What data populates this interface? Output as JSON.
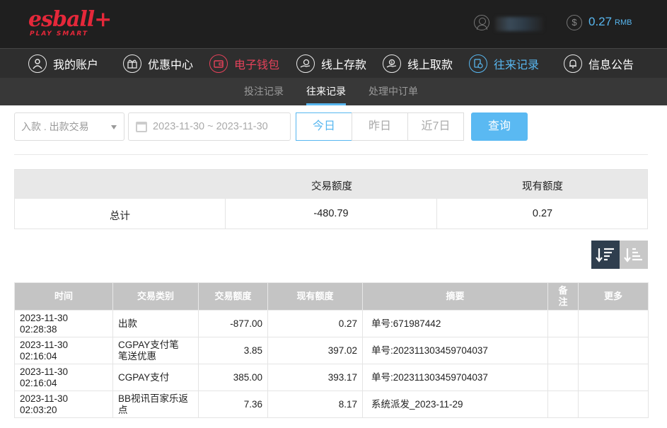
{
  "brand": {
    "logo_text": "esball+",
    "logo_sub": "PLAY SMART"
  },
  "header": {
    "balance": "0.27",
    "currency": "RMB",
    "user_icon": "user-icon",
    "coin_icon": "dollar-coin-icon"
  },
  "main_nav": [
    {
      "label": "我的账户",
      "icon": "user-circle-icon"
    },
    {
      "label": "优惠中心",
      "icon": "gift-icon"
    },
    {
      "label": "电子钱包",
      "icon": "wallet-icon"
    },
    {
      "label": "线上存款",
      "icon": "deposit-hand-icon"
    },
    {
      "label": "线上取款",
      "icon": "withdraw-hand-icon"
    },
    {
      "label": "往来记录",
      "icon": "record-clock-icon"
    },
    {
      "label": "信息公告",
      "icon": "bell-icon"
    }
  ],
  "sub_nav": [
    {
      "label": "投注记录"
    },
    {
      "label": "往来记录"
    },
    {
      "label": "处理中订单"
    }
  ],
  "filters": {
    "type_select": "入款 . 出款交易",
    "date_range": "2023-11-30 ~ 2023-11-30",
    "quick": [
      "今日",
      "昨日",
      "近7日"
    ],
    "search_label": "查询"
  },
  "summary": {
    "headers": [
      "",
      "交易额度",
      "现有额度"
    ],
    "row": {
      "label": "总计",
      "amount": "-480.79",
      "balance": "0.27"
    }
  },
  "records": {
    "headers": [
      "时间",
      "交易类别",
      "交易额度",
      "现有额度",
      "摘要",
      "备注",
      "更多"
    ],
    "rows": [
      {
        "time": "2023-11-30 02:28:38",
        "type": "出款",
        "amount": "-877.00",
        "balance": "0.27",
        "summary": "单号:671987442",
        "note": "",
        "more": ""
      },
      {
        "time": "2023-11-30 02:16:04",
        "type": "CGPAY支付笔笔送优惠",
        "amount": "3.85",
        "balance": "397.02",
        "summary": "单号:202311303459704037",
        "note": "",
        "more": ""
      },
      {
        "time": "2023-11-30 02:16:04",
        "type": "CGPAY支付",
        "amount": "385.00",
        "balance": "393.17",
        "summary": "单号:202311303459704037",
        "note": "",
        "more": ""
      },
      {
        "time": "2023-11-30 02:03:20",
        "type": "BB视讯百家乐返点",
        "amount": "7.36",
        "balance": "8.17",
        "summary": "系统派发_2023-11-29",
        "note": "",
        "more": ""
      }
    ]
  }
}
